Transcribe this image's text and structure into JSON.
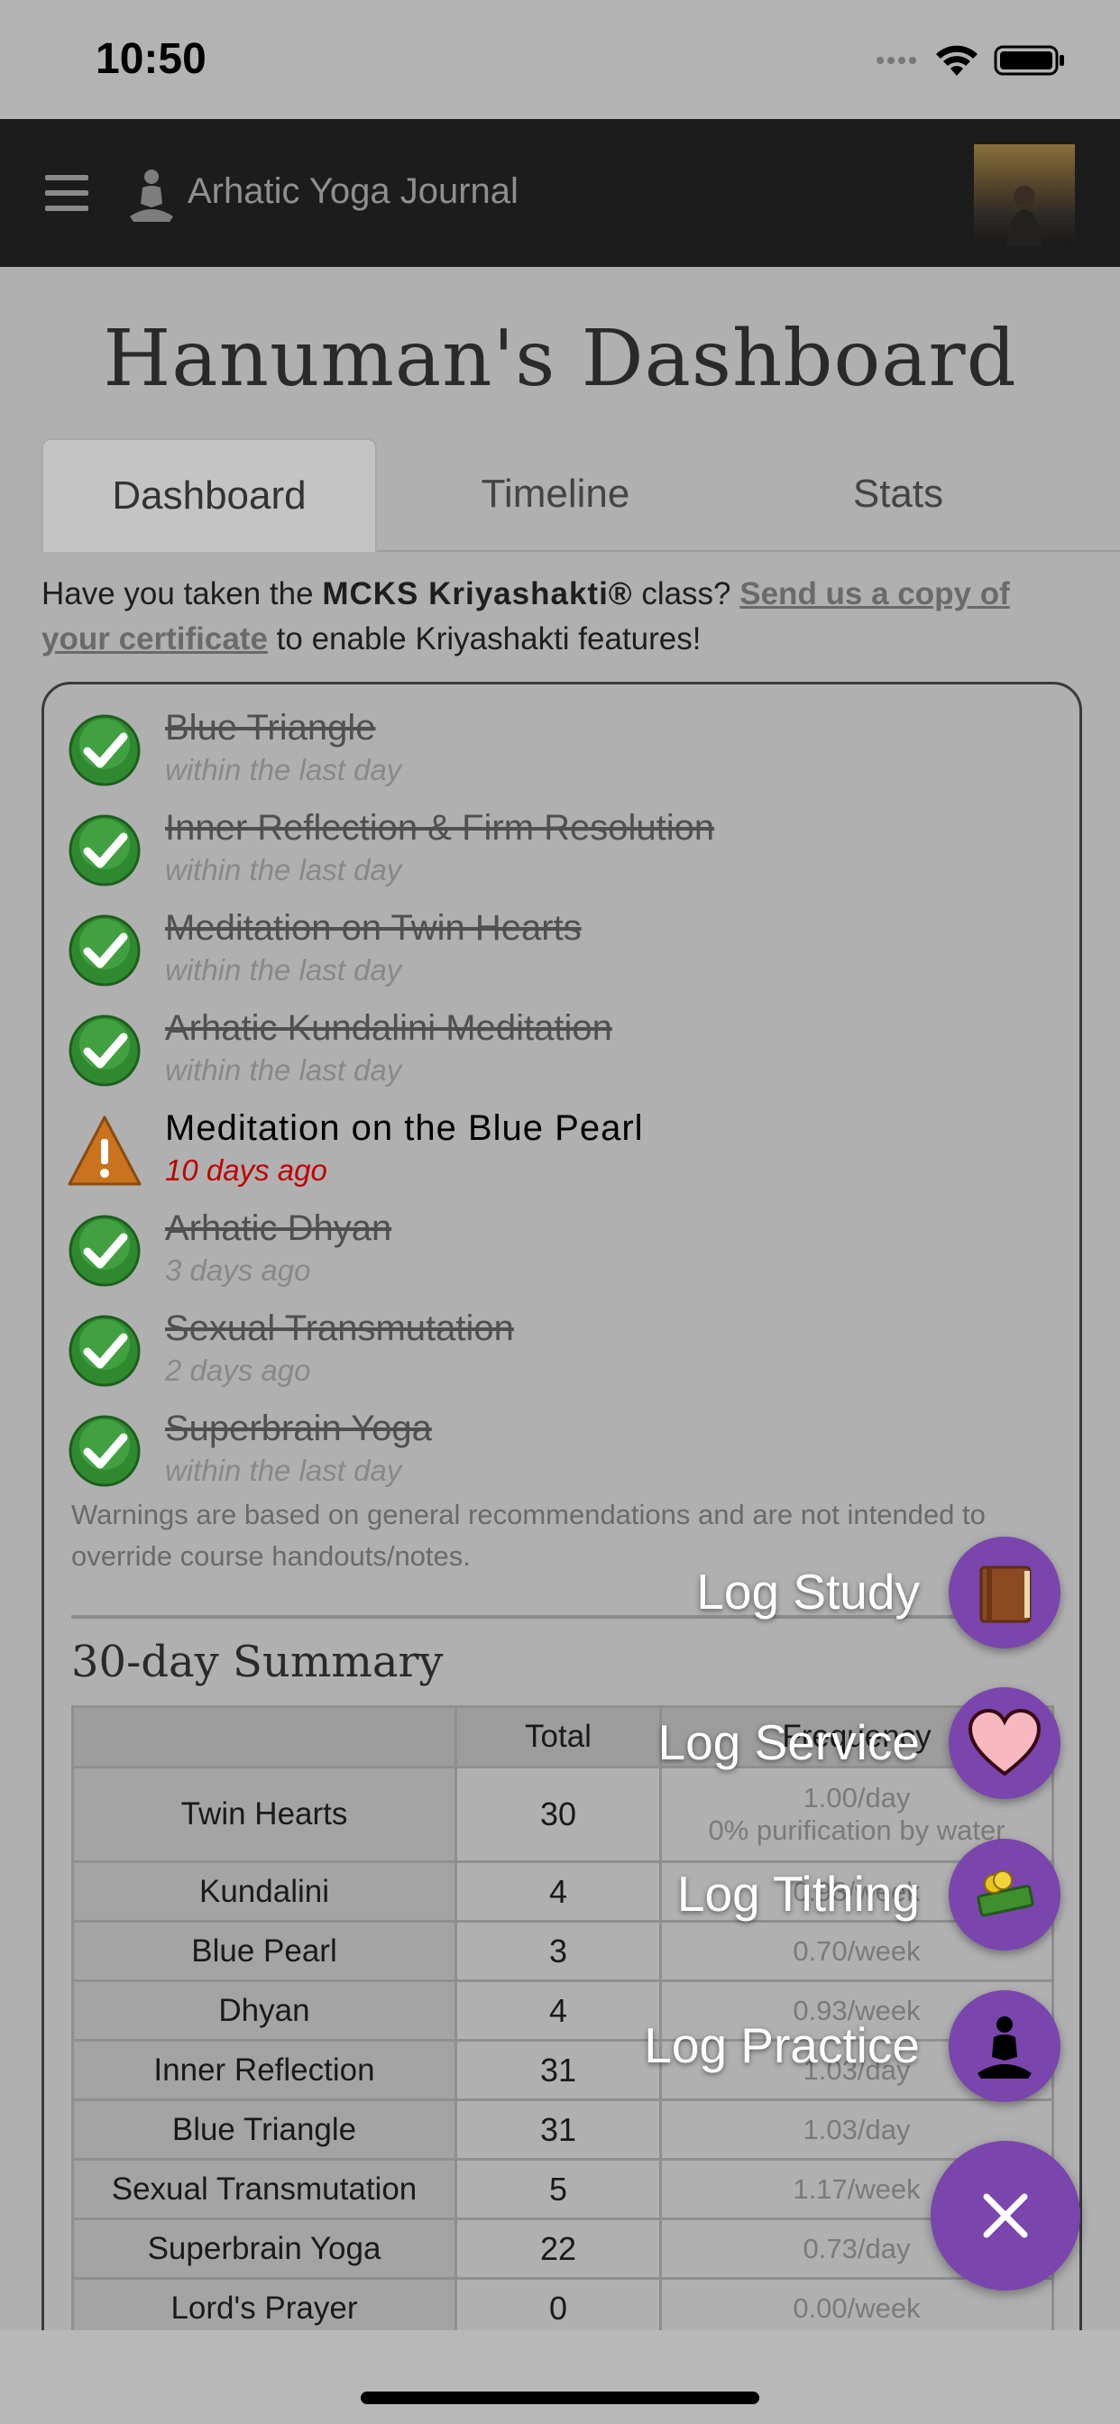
{
  "status": {
    "time": "10:50"
  },
  "nav": {
    "title": "Arhatic Yoga Journal"
  },
  "page": {
    "title": "Hanuman's Dashboard"
  },
  "tabs": [
    {
      "label": "Dashboard"
    },
    {
      "label": "Timeline"
    },
    {
      "label": "Stats"
    }
  ],
  "notice": {
    "pre": "Have you taken the ",
    "bold": "MCKS Kriyashakti®",
    "mid": " class? ",
    "link": "Send us a copy of your certificate",
    "post": " to enable Kriyashakti features!"
  },
  "practices": [
    {
      "name": "Blue Triangle",
      "when": "within the last day",
      "status": "done"
    },
    {
      "name": "Inner Reflection & Firm Resolution",
      "when": "within the last day",
      "status": "done"
    },
    {
      "name": "Meditation on Twin Hearts",
      "when": "within the last day",
      "status": "done"
    },
    {
      "name": "Arhatic Kundalini Meditation",
      "when": "within the last day",
      "status": "done"
    },
    {
      "name": "Meditation on the Blue Pearl",
      "when": "10 days ago",
      "status": "warning"
    },
    {
      "name": "Arhatic Dhyan",
      "when": "3 days ago",
      "status": "done"
    },
    {
      "name": "Sexual Transmutation",
      "when": "2 days ago",
      "status": "done"
    },
    {
      "name": "Superbrain Yoga",
      "when": "within the last day",
      "status": "done"
    }
  ],
  "disclaimer": "Warnings are based on general recommendations and are not intended to override course handouts/notes.",
  "summary": {
    "title": "30-day Summary",
    "headers": {
      "blank": "",
      "total": "Total",
      "frequency": "Frequency"
    },
    "rows": [
      {
        "name": "Twin Hearts",
        "total": "30",
        "freq": "1.00/day",
        "note": "0% purification by water"
      },
      {
        "name": "Kundalini",
        "total": "4",
        "freq": "0.93/week"
      },
      {
        "name": "Blue Pearl",
        "total": "3",
        "freq": "0.70/week"
      },
      {
        "name": "Dhyan",
        "total": "4",
        "freq": "0.93/week"
      },
      {
        "name": "Inner Reflection",
        "total": "31",
        "freq": "1.03/day"
      },
      {
        "name": "Blue Triangle",
        "total": "31",
        "freq": "1.03/day"
      },
      {
        "name": "Sexual Transmutation",
        "total": "5",
        "freq": "1.17/week"
      },
      {
        "name": "Superbrain Yoga",
        "total": "22",
        "freq": "0.73/day"
      },
      {
        "name": "Lord's Prayer",
        "total": "0",
        "freq": "0.00/week"
      }
    ]
  },
  "fab_menu": [
    {
      "label": "Log Study",
      "icon": "book-icon"
    },
    {
      "label": "Log Service",
      "icon": "heart-icon"
    },
    {
      "label": "Log Tithing",
      "icon": "money-icon"
    },
    {
      "label": "Log Practice",
      "icon": "meditation-icon"
    }
  ],
  "colors": {
    "accent": "#7a45ad",
    "warning_text": "#c00000"
  }
}
